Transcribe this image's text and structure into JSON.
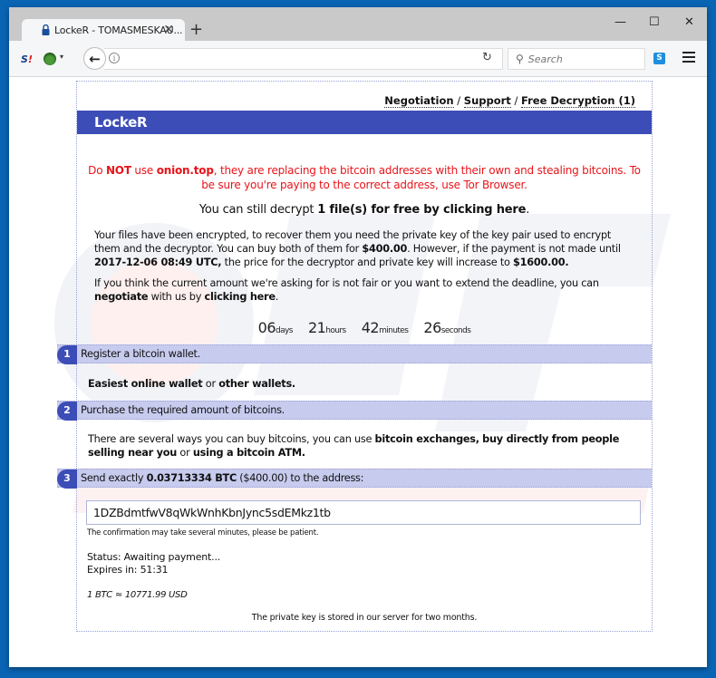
{
  "browser": {
    "tab_title": "LockeR - TOMASMESKAU...",
    "search_placeholder": "Search",
    "icons": {
      "tab_lock": "lock-icon",
      "tab_close": "close-icon",
      "new_tab": "plus-icon",
      "minimize": "minimize-icon",
      "maximize": "maximize-icon",
      "close_window": "close-icon",
      "ext_s": "S!",
      "ext_skype": "S",
      "back": "←",
      "info": "i",
      "reload": "↻",
      "search": "🔍",
      "menu": "hamburger-icon"
    },
    "glyphs": {
      "tab_close": "✕",
      "new_tab": "+",
      "minimize": "—",
      "maximize": "☐",
      "close_window": "✕",
      "ext_caret": "▾"
    }
  },
  "page": {
    "top_links": [
      {
        "label": "Negotiation"
      },
      {
        "label": "Support"
      },
      {
        "label": "Free Decryption (1)"
      }
    ],
    "link_separator": " / ",
    "brand": "LockeR",
    "brand_color": "#3d4db7",
    "warning": {
      "part1": "Do ",
      "bold1": "NOT",
      "part2": " use ",
      "bold2": "onion.top",
      "part3": ", they are replacing the bitcoin addresses with their own and stealing bitcoins. To be sure you're paying to the correct address, use Tor Browser.",
      "color": "#e8141a"
    },
    "free_decrypt": {
      "prefix": "You can still decrypt ",
      "link": "1 file(s) for free by clicking here",
      "suffix": "."
    },
    "paragraph1": {
      "t1": "Your files have been encrypted, to recover them you need the private key of the key pair used to encrypt them and the decryptor. You can buy both of them for ",
      "price": "$400.00",
      "t2": ". However, if the payment is not made until ",
      "deadline": "2017-12-06 08:49 UTC,",
      "t3": " the price for the decryptor and private key will increase to ",
      "price2": "$1600.00."
    },
    "paragraph2": {
      "t1": "If you think the current amount we're asking for is not fair or you want to extend the deadline, you can ",
      "negotiate": "negotiate",
      "t2": " with us by ",
      "link": "clicking here",
      "t3": "."
    },
    "countdown": [
      {
        "value": "06",
        "unit": "days"
      },
      {
        "value": "21",
        "unit": "hours"
      },
      {
        "value": "42",
        "unit": "minutes"
      },
      {
        "value": "26",
        "unit": "seconds"
      }
    ],
    "steps": [
      {
        "number": "1",
        "title": "Register a bitcoin wallet.",
        "body": {
          "link1": "Easiest online wallet",
          "mid": " or ",
          "link2": "other wallets."
        }
      },
      {
        "number": "2",
        "title": "Purchase the required amount of bitcoins.",
        "body": {
          "t1": "There are several ways you can buy bitcoins, you can use ",
          "link1": "bitcoin exchanges,",
          "t2": " ",
          "link2": "buy directly from people selling near you",
          "t3": " or ",
          "link3": "using a bitcoin ATM."
        }
      },
      {
        "number": "3",
        "title_prefix": "Send exactly ",
        "amount_btc": "0.03713334 BTC",
        "title_suffix": " ($400.00) to the address:"
      }
    ],
    "btc_address": "1DZBdmtfwV8qWkWnhKbnJync5sdEMkz1tb",
    "confirmation_note": "The confirmation may take several minutes, please be patient.",
    "status": "Status: Awaiting payment...",
    "expires": "Expires in: 51:31",
    "rate": "1 BTC ≈ 10771.99 USD",
    "stored_note": "The private key is stored in our server for two months."
  }
}
